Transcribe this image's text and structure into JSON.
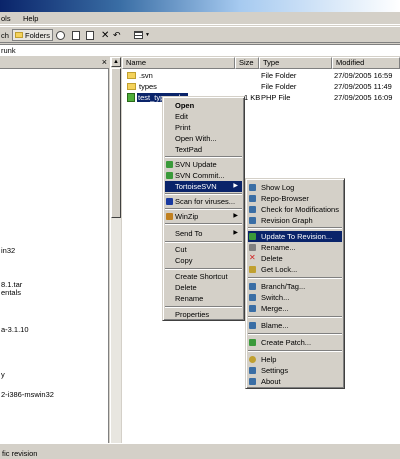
{
  "menubar": {
    "tools": "ols",
    "help": "Help"
  },
  "toolbar": {
    "search_label": "ch",
    "folders_label": "Folders"
  },
  "address": {
    "value": "runk"
  },
  "left_pane": {
    "items": [
      "in32",
      "8.1.tar",
      "entals",
      "a-3.1.10",
      "y",
      "2-i386-mswin32"
    ]
  },
  "columns": {
    "name": "Name",
    "size": "Size",
    "type": "Type",
    "modified": "Modified"
  },
  "files": [
    {
      "name": ".svn",
      "size": "",
      "type": "File Folder",
      "modified": "27/09/2005 16:59"
    },
    {
      "name": "types",
      "size": "",
      "type": "File Folder",
      "modified": "27/09/2005 11:49"
    },
    {
      "name": "test_types.php",
      "size": "1 KB",
      "type": "PHP File",
      "modified": "27/09/2005 16:09"
    }
  ],
  "context_menu": {
    "open": "Open",
    "edit": "Edit",
    "print": "Print",
    "open_with": "Open With...",
    "textpad": "TextPad",
    "svn_update": "SVN Update",
    "svn_commit": "SVN Commit...",
    "tortoisesvn": "TortoiseSVN",
    "scan": "Scan for viruses...",
    "winzip": "WinZip",
    "send_to": "Send To",
    "cut": "Cut",
    "copy": "Copy",
    "create_shortcut": "Create Shortcut",
    "delete": "Delete",
    "rename": "Rename",
    "properties": "Properties"
  },
  "submenu": {
    "show_log": "Show Log",
    "repo_browser": "Repo-Browser",
    "check_mods": "Check for Modifications",
    "revision_graph": "Revision Graph",
    "update_to_revision": "Update To Revision...",
    "rename": "Rename...",
    "delete": "Delete",
    "get_lock": "Get Lock...",
    "branch_tag": "Branch/Tag...",
    "switch": "Switch...",
    "merge": "Merge...",
    "blame": "Blame...",
    "create_patch": "Create Patch...",
    "help": "Help",
    "settings": "Settings",
    "about": "About"
  },
  "status": {
    "text": "fic revision"
  },
  "colors": {
    "highlight": "#0a246a",
    "chrome": "#d4d0c8"
  }
}
